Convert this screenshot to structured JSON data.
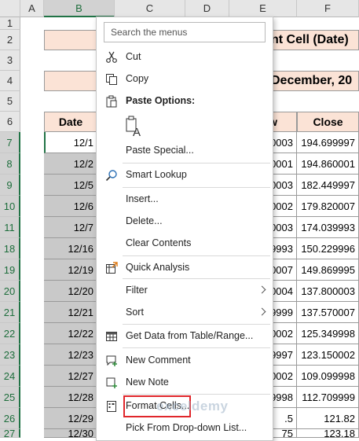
{
  "columns": [
    "A",
    "B",
    "C",
    "D",
    "E",
    "F"
  ],
  "rows": [
    "1",
    "2",
    "3",
    "4",
    "5",
    "6",
    "7",
    "8",
    "9",
    "10",
    "11",
    "18",
    "19",
    "20",
    "21",
    "22",
    "23",
    "24",
    "25",
    "26",
    "27"
  ],
  "title_fragment": "nt Cell (Date)",
  "subtitle_fragment": "December, 20",
  "table": {
    "date_header": "Date",
    "low_header": "w",
    "close_header": "Close",
    "dates": [
      "12/1",
      "12/2",
      "12/5",
      "12/6",
      "12/7",
      "12/16",
      "12/19",
      "12/20",
      "12/21",
      "12/22",
      "12/23",
      "12/27",
      "12/28",
      "12/29",
      "12/30"
    ],
    "low": [
      "0003",
      "0001",
      "0003",
      "0002",
      "0003",
      "9993",
      "0007",
      "0004",
      "9999",
      "0002",
      "9997",
      "0002",
      "9998",
      ".5",
      "75"
    ],
    "close": [
      "194.699997",
      "194.860001",
      "182.449997",
      "179.820007",
      "174.039993",
      "150.229996",
      "149.869995",
      "137.800003",
      "137.570007",
      "125.349998",
      "123.150002",
      "109.099998",
      "112.709999",
      "121.82",
      "123.18"
    ]
  },
  "menu": {
    "search_placeholder": "Search the menus",
    "cut": "Cut",
    "copy": "Copy",
    "paste_options": "Paste Options:",
    "paste_special": "Paste Special...",
    "smart_lookup": "Smart Lookup",
    "insert": "Insert...",
    "delete": "Delete...",
    "clear_contents": "Clear Contents",
    "quick_analysis": "Quick Analysis",
    "filter": "Filter",
    "sort": "Sort",
    "get_data": "Get Data from Table/Range...",
    "new_comment": "New Comment",
    "new_note": "New Note",
    "format_cells": "Format Cells...",
    "pick_list": "Pick From Drop-down List..."
  },
  "watermark": "exceldemy",
  "colors": {
    "accent": "#217346",
    "highlight_box": "#e0262b",
    "salmon": "#fbe3d6",
    "selection_grey": "#c9c9c9"
  }
}
